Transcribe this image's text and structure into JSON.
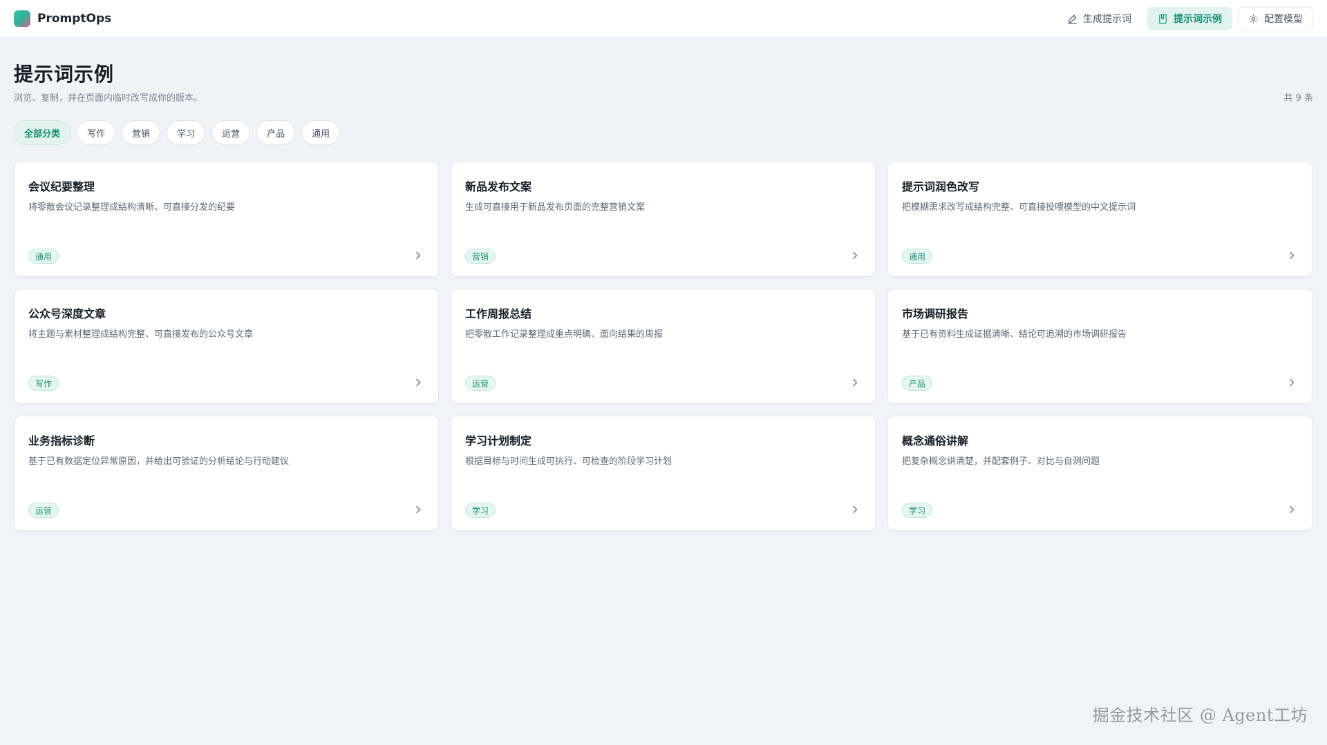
{
  "app": {
    "name": "PromptOps"
  },
  "nav": {
    "generate": {
      "label": "生成提示词",
      "icon": "pen-icon"
    },
    "examples": {
      "label": "提示词示例",
      "icon": "book-icon"
    },
    "config": {
      "label": "配置模型",
      "icon": "gear-icon"
    }
  },
  "page": {
    "title": "提示词示例",
    "subtitle": "浏览、复制，并在页面内临时改写成你的版本。",
    "count": "共 9 条"
  },
  "filters": [
    "全部分类",
    "写作",
    "营销",
    "学习",
    "运营",
    "产品",
    "通用"
  ],
  "cards": [
    {
      "title": "会议纪要整理",
      "desc": "将零散会议记录整理成结构清晰、可直接分发的纪要",
      "tag": "通用"
    },
    {
      "title": "新品发布文案",
      "desc": "生成可直接用于新品发布页面的完整营销文案",
      "tag": "营销"
    },
    {
      "title": "提示词润色改写",
      "desc": "把模糊需求改写成结构完整、可直接投喂模型的中文提示词",
      "tag": "通用"
    },
    {
      "title": "公众号深度文章",
      "desc": "将主题与素材整理成结构完整、可直接发布的公众号文章",
      "tag": "写作"
    },
    {
      "title": "工作周报总结",
      "desc": "把零散工作记录整理成重点明确、面向结果的周报",
      "tag": "运营"
    },
    {
      "title": "市场调研报告",
      "desc": "基于已有资料生成证据清晰、结论可追溯的市场调研报告",
      "tag": "产品"
    },
    {
      "title": "业务指标诊断",
      "desc": "基于已有数据定位异常原因，并给出可验证的分析结论与行动建议",
      "tag": "运营"
    },
    {
      "title": "学习计划制定",
      "desc": "根据目标与时间生成可执行、可检查的阶段学习计划",
      "tag": "学习"
    },
    {
      "title": "概念通俗讲解",
      "desc": "把复杂概念讲清楚，并配套例子、对比与自测问题",
      "tag": "学习"
    }
  ],
  "watermark": "掘金技术社区 @ Agent工坊",
  "colors": {
    "accent": "#138e76",
    "accent_bg": "#e2f3ef",
    "background": "#f1f3f8"
  }
}
